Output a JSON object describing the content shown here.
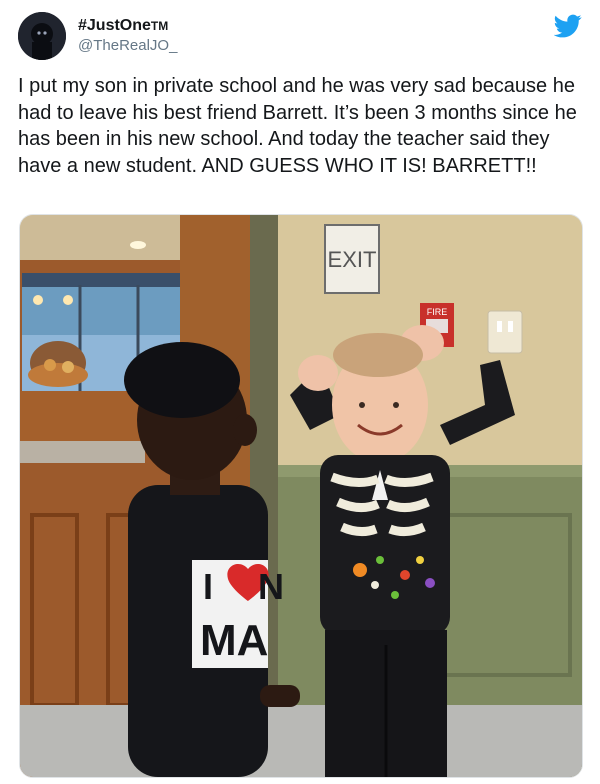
{
  "tweet": {
    "author": {
      "display_name": "#JustOne",
      "name_mark": "TM",
      "handle": "@TheRealJO_",
      "avatar_icon": "avatar-photo"
    },
    "brand_icon": "twitter-bird-icon",
    "brand_color": "#1DA1F2",
    "text": "I put my son in private school and he was very sad because he had to leave his best friend Barrett. It’s been 3 months since he has been in his new school. And today the teacher said they have a new student. AND GUESS WHO IT IS! BARRETT!!",
    "photo": {
      "exit_sign": "EXIT",
      "fire_alarm": "FIRE",
      "shirt_left": {
        "line1": "I",
        "line2_partial": "N",
        "line3": "MA"
      }
    }
  }
}
